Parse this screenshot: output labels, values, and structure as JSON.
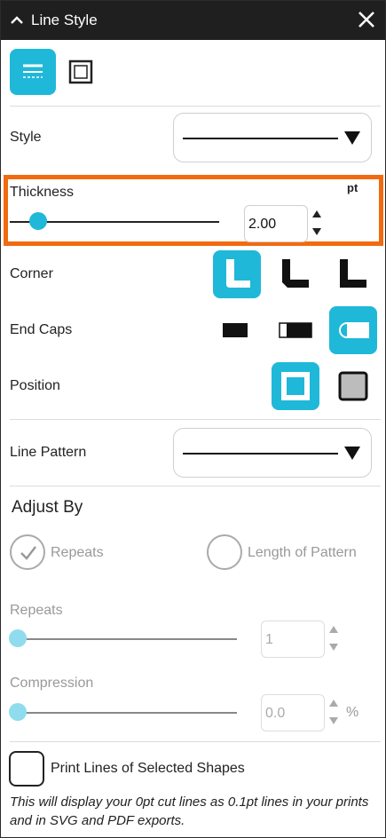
{
  "header": {
    "title": "Line Style"
  },
  "tabs": {
    "active": "line-settings",
    "items": [
      "line-settings",
      "outline-box"
    ]
  },
  "style": {
    "label": "Style",
    "value_icon": "solid-line"
  },
  "thickness": {
    "label": "Thickness",
    "unit": "pt",
    "value": "2.00",
    "slider_fraction": 0.12
  },
  "corner": {
    "label": "Corner",
    "options": [
      "round-corner",
      "bevel-corner",
      "miter-corner"
    ],
    "selected": "round-corner"
  },
  "end_caps": {
    "label": "End Caps",
    "options": [
      "butt-cap",
      "square-cap",
      "round-cap"
    ],
    "selected": "round-cap"
  },
  "position": {
    "label": "Position",
    "options": [
      "center",
      "inside"
    ],
    "selected": "center"
  },
  "line_pattern": {
    "label": "Line Pattern",
    "value_icon": "solid-line"
  },
  "adjust_by": {
    "heading": "Adjust By",
    "options": [
      {
        "label": "Repeats",
        "checked": true
      },
      {
        "label": "Length of Pattern",
        "checked": false
      }
    ]
  },
  "repeats": {
    "label": "Repeats",
    "value": "1",
    "slider_fraction": 0.0
  },
  "compression": {
    "label": "Compression",
    "value": "0.0",
    "unit": "%",
    "slider_fraction": 0.0
  },
  "print_lines": {
    "label": "Print Lines of Selected Shapes",
    "checked": false,
    "note": "This will display your 0pt cut lines as 0.1pt lines in your prints and in SVG and PDF exports."
  },
  "colors": {
    "accent": "#1fb8d9",
    "highlight": "#f26a0f",
    "titlebar": "#1f1f1f"
  }
}
